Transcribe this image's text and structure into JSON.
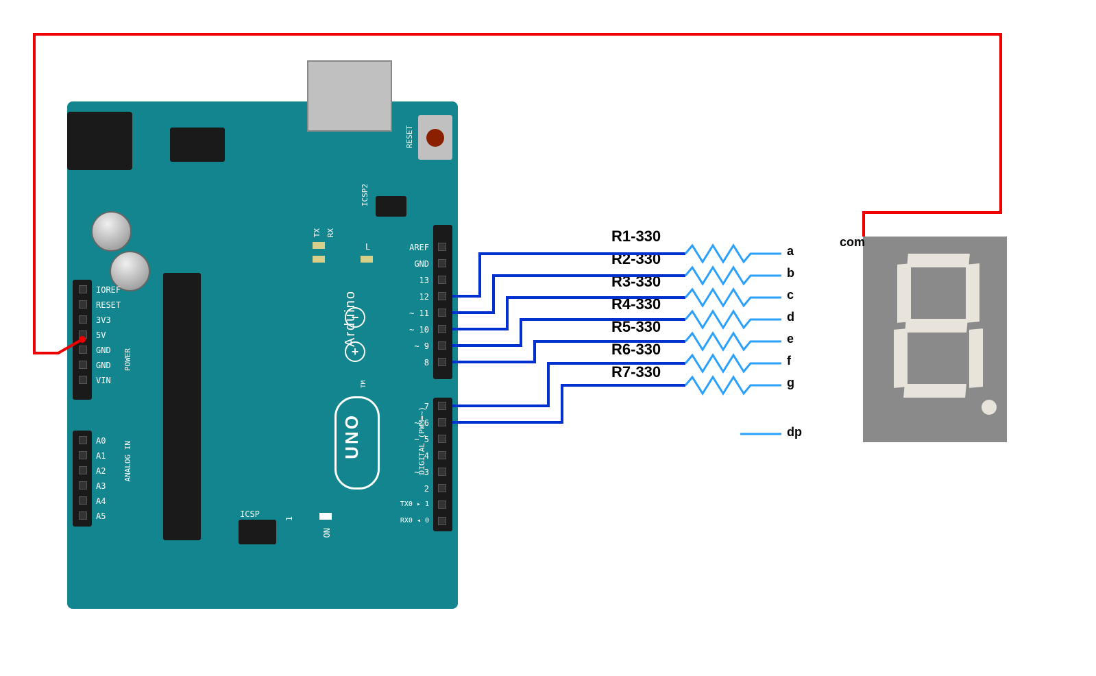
{
  "arduino": {
    "name": "Arduino",
    "model": "UNO",
    "tm": "TM",
    "reset": "RESET",
    "icsp2": "ICSP2",
    "icsp": "ICSP",
    "on": "ON",
    "one": "1",
    "tx": "TX",
    "rx": "RX",
    "l": "L",
    "digital": "DIGITAL (PWM=~)",
    "power": "POWER",
    "analog": "ANALOG IN",
    "left_pins": [
      "IOREF",
      "RESET",
      "3V3",
      "5V",
      "GND",
      "GND",
      "VIN"
    ],
    "analog_pins": [
      "A0",
      "A1",
      "A2",
      "A3",
      "A4",
      "A5"
    ],
    "right_pins_top": [
      "AREF",
      "GND",
      "13",
      "12",
      "~ 11",
      "~ 10",
      "~ 9",
      "8"
    ],
    "right_pins_bot": [
      "7",
      "~ 6",
      "~ 5",
      "4",
      "~ 3",
      "2",
      "TX0 ▸ 1",
      "RX0 ◂ 0"
    ]
  },
  "resistors": [
    {
      "label": "R1-330"
    },
    {
      "label": "R2-330"
    },
    {
      "label": "R3-330"
    },
    {
      "label": "R4-330"
    },
    {
      "label": "R5-330"
    },
    {
      "label": "R6-330"
    },
    {
      "label": "R7-330"
    }
  ],
  "seven_seg": {
    "com": "com",
    "pins": [
      "a",
      "b",
      "c",
      "d",
      "e",
      "f",
      "g",
      "dp"
    ]
  },
  "chart_data": {
    "type": "diagram",
    "connections": [
      {
        "from": "Arduino 5V",
        "to": "7-seg com",
        "via": "wire",
        "color": "red"
      },
      {
        "from": "Arduino D12",
        "to": "7-seg a",
        "via": "R1-330",
        "color": "blue"
      },
      {
        "from": "Arduino D11",
        "to": "7-seg b",
        "via": "R2-330",
        "color": "blue"
      },
      {
        "from": "Arduino D10",
        "to": "7-seg c",
        "via": "R3-330",
        "color": "blue"
      },
      {
        "from": "Arduino D9",
        "to": "7-seg d",
        "via": "R4-330",
        "color": "blue"
      },
      {
        "from": "Arduino D8",
        "to": "7-seg e",
        "via": "R5-330",
        "color": "blue"
      },
      {
        "from": "Arduino D7",
        "to": "7-seg f",
        "via": "R6-330",
        "color": "blue"
      },
      {
        "from": "Arduino D6",
        "to": "7-seg g",
        "via": "R7-330",
        "color": "blue"
      }
    ],
    "components": [
      "Arduino UNO",
      "7-segment display (common anode/cathode)",
      "7 × 330Ω resistors"
    ]
  }
}
